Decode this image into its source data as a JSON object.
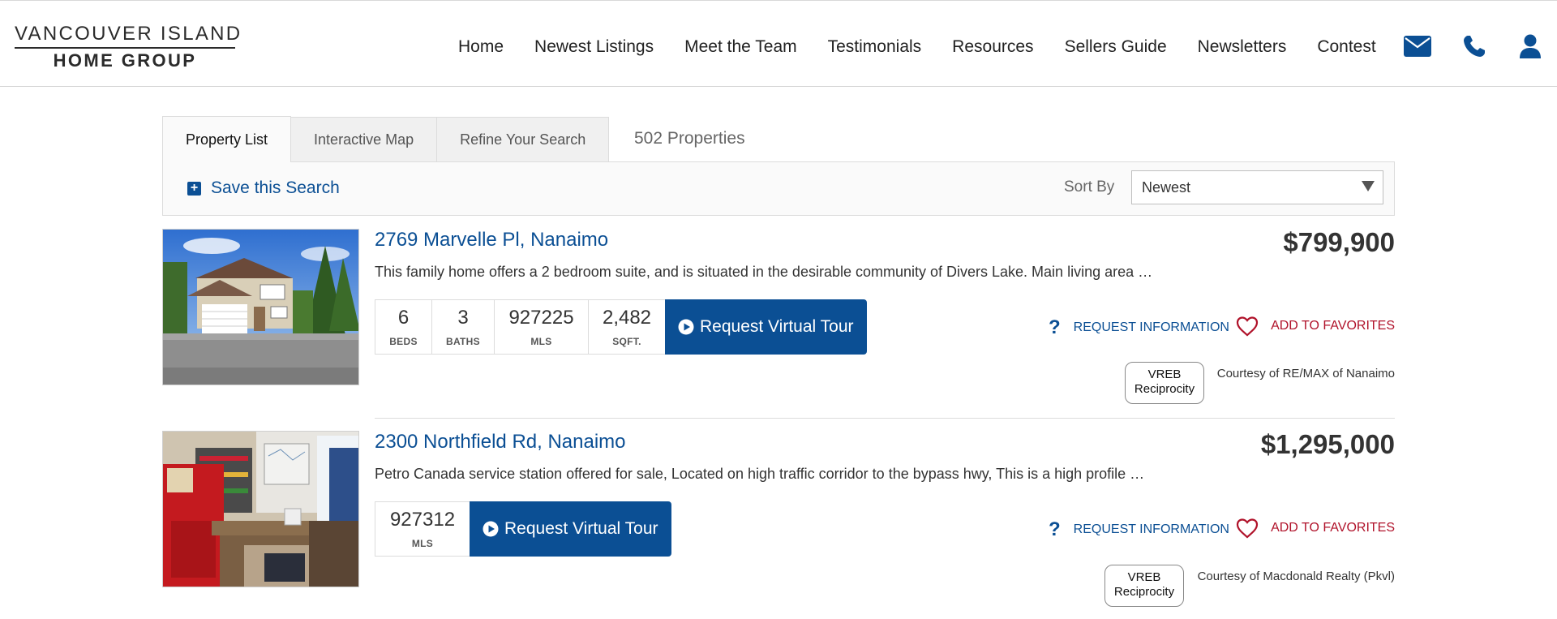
{
  "brand": {
    "line1": "VANCOUVER ISLAND",
    "line2": "HOME GROUP"
  },
  "nav": {
    "items": [
      "Home",
      "Newest Listings",
      "Meet the Team",
      "Testimonials",
      "Resources",
      "Sellers Guide",
      "Newsletters",
      "Contest"
    ],
    "icons": [
      "envelope-icon",
      "phone-icon",
      "user-icon"
    ]
  },
  "tabs": {
    "items": [
      "Property List",
      "Interactive Map",
      "Refine Your Search"
    ],
    "active": "Property List",
    "count_text": "502 Properties"
  },
  "toolbar": {
    "save_search": "Save this Search",
    "sort_label": "Sort By",
    "sort_value": "Newest"
  },
  "colors": {
    "link_blue": "#0b4f94",
    "favorite_red": "#b0122a",
    "price_text": "#333333"
  },
  "listings": [
    {
      "address": "2769 Marvelle Pl, Nanaimo",
      "description": "This family home offers a 2 bedroom suite, and is situated in the desirable community of Divers Lake. Main living area …",
      "price": "$799,900",
      "stats": [
        {
          "value": "6",
          "label": "BEDS"
        },
        {
          "value": "3",
          "label": "BATHS"
        },
        {
          "value": "927225",
          "label": "MLS"
        },
        {
          "value": "2,482",
          "label": "SQFT."
        }
      ],
      "virtual_tour": "Request Virtual Tour",
      "request_info": "REQUEST INFORMATION",
      "add_favorites": "ADD TO FAVORITES",
      "badge_line1": "VREB",
      "badge_line2": "Reciprocity",
      "courtesy": "Courtesy of RE/MAX of Nanaimo"
    },
    {
      "address": "2300 Northfield Rd, Nanaimo",
      "description": "Petro Canada service station offered for sale, Located on high traffic corridor to the bypass hwy, This is a high profile …",
      "price": "$1,295,000",
      "stats": [
        {
          "value": "927312",
          "label": "MLS"
        }
      ],
      "virtual_tour": "Request Virtual Tour",
      "request_info": "REQUEST INFORMATION",
      "add_favorites": "ADD TO FAVORITES",
      "badge_line1": "VREB",
      "badge_line2": "Reciprocity",
      "courtesy": "Courtesy of Macdonald Realty (Pkvl)"
    }
  ]
}
